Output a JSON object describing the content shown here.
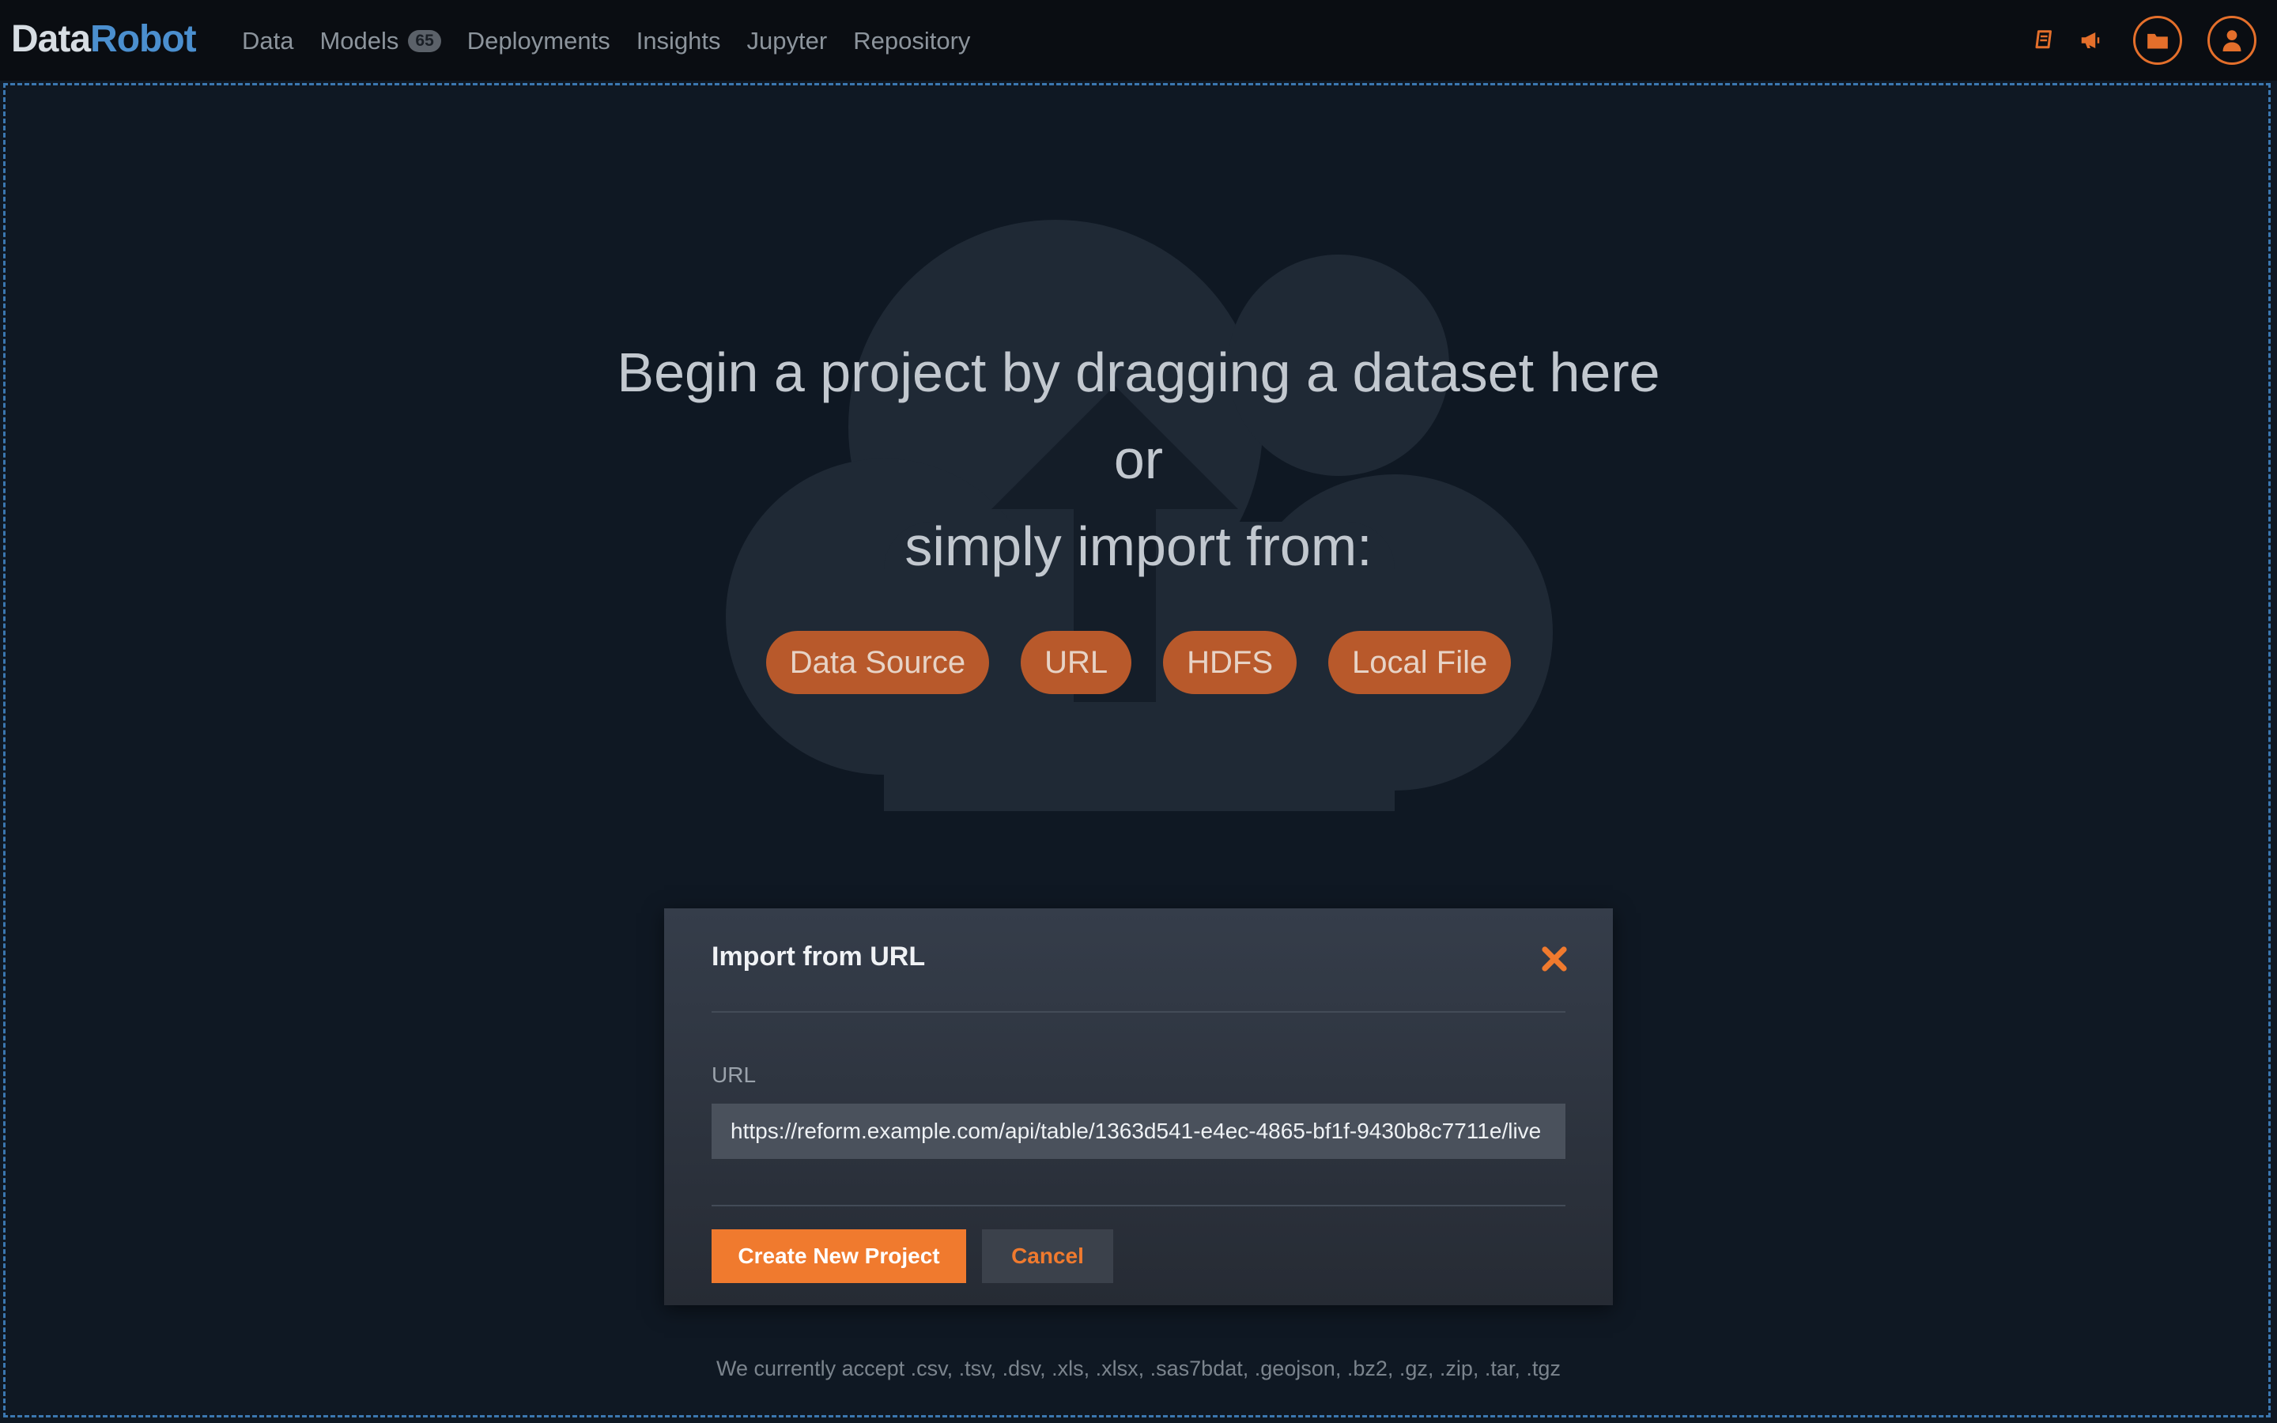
{
  "brand": {
    "part1": "Data",
    "part2": "Robot"
  },
  "nav": {
    "items": [
      {
        "label": "Data"
      },
      {
        "label": "Models",
        "badge": "65"
      },
      {
        "label": "Deployments"
      },
      {
        "label": "Insights"
      },
      {
        "label": "Jupyter"
      },
      {
        "label": "Repository"
      }
    ]
  },
  "top_icons": [
    "book-icon",
    "megaphone-icon",
    "folder-icon",
    "user-icon"
  ],
  "dropzone": {
    "line1": "Begin a project by dragging a dataset here",
    "line2": "or",
    "line3": "simply import from:",
    "sources": [
      "Data Source",
      "URL",
      "HDFS",
      "Local File"
    ],
    "accepted": "We currently accept .csv, .tsv, .dsv, .xls, .xlsx, .sas7bdat, .geojson, .bz2, .gz, .zip, .tar, .tgz"
  },
  "modal": {
    "title": "Import from URL",
    "url_label": "URL",
    "url_value": "https://reform.example.com/api/table/1363d541-e4ec-4865-bf1f-9430b8c7711e/live",
    "create_label": "Create New Project",
    "cancel_label": "Cancel"
  },
  "colors": {
    "accent": "#f07a2e",
    "brand_blue": "#4b8fcf",
    "background": "#0f1823",
    "topbar": "#0a0d12"
  }
}
